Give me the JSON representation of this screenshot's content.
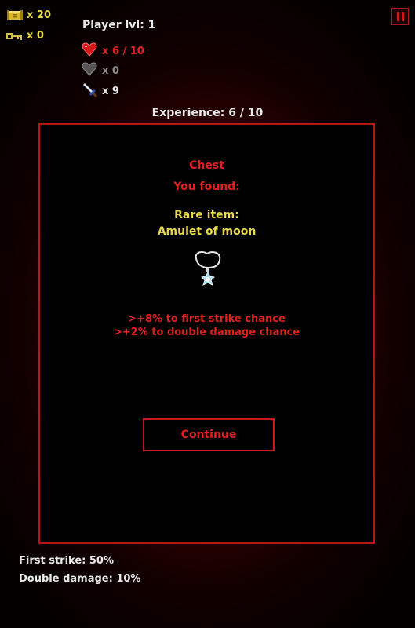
{
  "resources": {
    "gold_count": "x 20",
    "keys_count": "x 0"
  },
  "player": {
    "level_label": "Player lvl: 1",
    "health": "x 6 / 10",
    "armor": "x 0",
    "attack": "x 9",
    "experience": "Experience: 6 / 10"
  },
  "modal": {
    "title": "Chest",
    "found_label": "You found:",
    "rarity": "Rare item:",
    "item_name": "Amulet of moon",
    "bonuses": [
      ">+8% to first strike chance",
      ">+2% to double damage chance"
    ],
    "continue_label": "Continue"
  },
  "footer": {
    "first_strike": "First strike: 50%",
    "double_damage": "Double damage: 10%"
  },
  "colors": {
    "accent_red": "#e02020",
    "gold": "#e6d84a",
    "text_white": "#eaeaea",
    "muted_grey": "#8a8a8a"
  },
  "icons": [
    "scroll-icon",
    "key-icon",
    "heart-icon",
    "shield-icon",
    "sword-icon",
    "amulet-icon",
    "pause-icon"
  ]
}
